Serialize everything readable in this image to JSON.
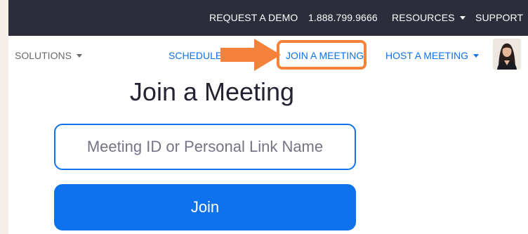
{
  "topbar": {
    "request_demo": "REQUEST A DEMO",
    "phone": "1.888.799.9666",
    "resources": "RESOURCES",
    "support": "SUPPORT"
  },
  "navbar": {
    "solutions": "SOLUTIONS",
    "schedule": "SCHEDULE",
    "join_meeting": "JOIN A MEETING",
    "host_meeting": "HOST A MEETING"
  },
  "main": {
    "title": "Join a Meeting",
    "meeting_input": {
      "value": "",
      "placeholder": "Meeting ID or Personal Link Name"
    },
    "join_label": "Join"
  },
  "icons": {
    "caret": "chevron-down-icon",
    "annotation_arrow": "arrow-right-icon",
    "avatar": "user-avatar"
  },
  "colors": {
    "topbar_bg": "#2b2d3a",
    "accent": "#0e72ed",
    "annotation": "#f5823a"
  }
}
